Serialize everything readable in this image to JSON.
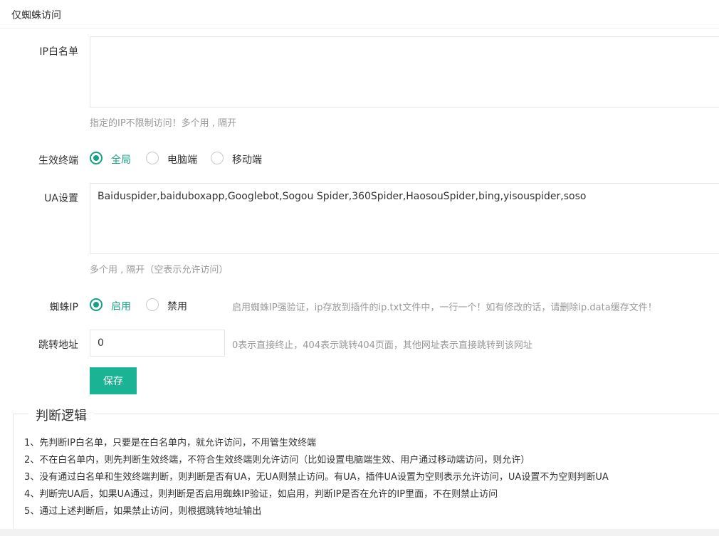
{
  "panel": {
    "title": "仅蜘蛛访问"
  },
  "ip_whitelist": {
    "label": "IP白名单",
    "value": "",
    "hint": "指定的IP不限制访问！多个用 , 隔开"
  },
  "terminal": {
    "label": "生效终端",
    "options": [
      "全局",
      "电脑端",
      "移动端"
    ],
    "selected": "全局"
  },
  "ua": {
    "label": "UA设置",
    "value": "Baiduspider,baiduboxapp,Googlebot,Sogou Spider,360Spider,HaosouSpider,bing,yisouspider,soso",
    "hint": "多个用 , 隔开（空表示允许访问）"
  },
  "spider_ip": {
    "label": "蜘蛛IP",
    "options": [
      "启用",
      "禁用"
    ],
    "selected": "启用",
    "hint": "启用蜘蛛IP强验证，ip存放到插件的ip.txt文件中，一行一个！如有修改的话，请删除ip.data缓存文件！"
  },
  "redirect": {
    "label": "跳转地址",
    "value": "0",
    "hint": "0表示直接终止，404表示跳转404页面，其他网址表示直接跳转到该网址"
  },
  "save_label": "保存",
  "logic": {
    "title": "判断逻辑",
    "items": [
      "1、先判断IP白名单，只要是在白名单内，就允许访问，不用管生效终端",
      "2、不在白名单内，则先判断生效终端，不符合生效终端则允许访问（比如设置电脑端生效、用户通过移动端访问，则允许）",
      "3、没有通过白名单和生效终端判断，则判断是否有UA，无UA则禁止访问。有UA，插件UA设置为空则表示允许访问，UA设置不为空则判断UA",
      "4、判断完UA后，如果UA通过，则判断是否启用蜘蛛IP验证，如启用，判断IP是否在允许的IP里面，不在则禁止访问",
      "5、通过上述判断后，如果禁止访问，则根据跳转地址输出"
    ]
  },
  "colors": {
    "accent": "#16a085",
    "button": "#1ab394",
    "hint": "#999999",
    "border": "#e6e6e6"
  }
}
